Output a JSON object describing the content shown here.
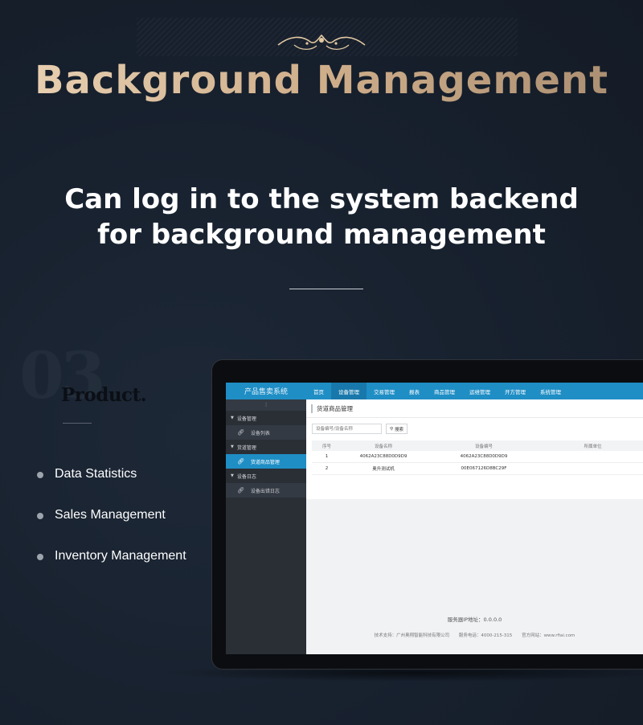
{
  "hero": {
    "title": "Background Management",
    "subtitle_line1": "Can log in to the system backend",
    "subtitle_line2": "for background management"
  },
  "feature_section": {
    "number_watermark": "03",
    "product_label": "Product.",
    "features": [
      "Data Statistics",
      "Sales Management",
      "Inventory Management"
    ]
  },
  "app": {
    "brand": "产品售卖系统",
    "nav": [
      {
        "label": "首页",
        "active": false
      },
      {
        "label": "设备管理",
        "active": true
      },
      {
        "label": "交易管理",
        "active": false
      },
      {
        "label": "报表",
        "active": false
      },
      {
        "label": "商品管理",
        "active": false
      },
      {
        "label": "运维管理",
        "active": false
      },
      {
        "label": "开方管理",
        "active": false
      },
      {
        "label": "系统管理",
        "active": false
      }
    ],
    "sidebar": {
      "toggle": "⫶",
      "groups": [
        {
          "label": "设备管理",
          "items": [
            {
              "label": "设备列表",
              "active": false
            }
          ]
        },
        {
          "label": "货道管理",
          "items": [
            {
              "label": "货道商品管理",
              "active": true
            }
          ]
        },
        {
          "label": "设备日志",
          "items": [
            {
              "label": "设备出错日志",
              "active": false
            }
          ]
        }
      ]
    },
    "panel": {
      "title": "货道商品管理",
      "search_placeholder": "设备编号/设备名称",
      "search_button": "搜索",
      "columns": [
        "序号",
        "设备名称",
        "设备编号",
        "所属单位"
      ],
      "rows": [
        [
          "1",
          "4062A23C88D0D9D9",
          "4062A23C88D0D9D9",
          ""
        ],
        [
          "2",
          "奥升测试机",
          "00E067126D8BC29F",
          ""
        ]
      ]
    },
    "footer": {
      "ip": "服务器IP地址：0.0.0.0",
      "support": "技术支持：广州奥翔智能科技有限公司",
      "phone": "服务电话：4000-215-315",
      "website": "官方网站：www.rfiai.com"
    }
  },
  "colors": {
    "background": "#17202d",
    "title_gold": "#d8bc9a",
    "app_blue": "#1f8ec5",
    "sidebar": "#2a2f36"
  }
}
